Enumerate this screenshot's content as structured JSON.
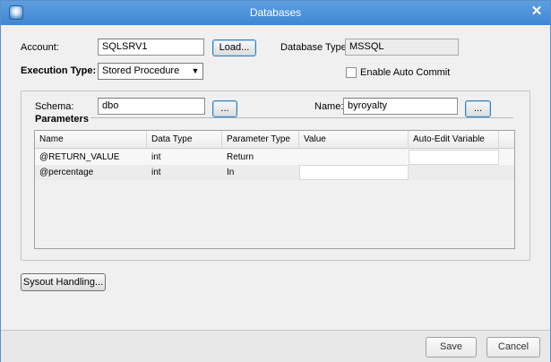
{
  "window": {
    "title": "Databases",
    "icons": {
      "app": "database-icon",
      "close": "close-icon"
    }
  },
  "account": {
    "label": "Account:",
    "value": "SQLSRV1",
    "load_label": "Load..."
  },
  "database_type": {
    "label": "Database Type:",
    "value": "MSSQL"
  },
  "execution_type": {
    "label": "Execution Type:",
    "value": "Stored Procedure"
  },
  "auto_commit": {
    "label": "Enable Auto Commit",
    "checked": false
  },
  "schema": {
    "label": "Schema:",
    "value": "dbo",
    "browse_label": "..."
  },
  "name": {
    "label": "Name:",
    "value": "byroyalty",
    "browse_label": "..."
  },
  "parameters": {
    "title": "Parameters",
    "columns": [
      "Name",
      "Data Type",
      "Parameter Type",
      "Value",
      "Auto-Edit Variable"
    ],
    "rows": [
      {
        "name": "@RETURN_VALUE",
        "data_type": "int",
        "parameter_type": "Return",
        "value": "",
        "auto_edit": ""
      },
      {
        "name": "@percentage",
        "data_type": "int",
        "parameter_type": "In",
        "value": "",
        "auto_edit": ""
      }
    ]
  },
  "sysout": {
    "label": "Sysout Handling..."
  },
  "footer": {
    "save_label": "Save",
    "cancel_label": "Cancel"
  }
}
